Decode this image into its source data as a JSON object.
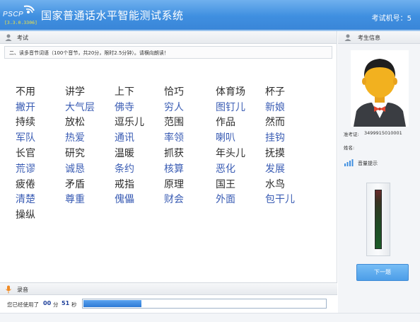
{
  "header": {
    "logo_text": "PSCP",
    "version": "[3.3.0.3306]",
    "title": "国家普通话水平智能测试系统",
    "machine_label": "考试机号：5"
  },
  "exam_panel": {
    "title": "考试",
    "instruction": "二、读多音节词语（100个音节，共20分，限时2.5分钟）。请横向朗读！"
  },
  "word_rows": [
    {
      "style": "black",
      "words": [
        "不用",
        "讲学",
        "上下",
        "恰巧",
        "体育场",
        "杯子"
      ]
    },
    {
      "style": "blue",
      "words": [
        "撇开",
        "大气层",
        "佛寺",
        "穷人",
        "图钉儿",
        "新娘"
      ]
    },
    {
      "style": "black",
      "words": [
        "持续",
        "放松",
        "逗乐儿",
        "范围",
        "作品",
        "然而"
      ]
    },
    {
      "style": "blue",
      "words": [
        "军队",
        "热爱",
        "通讯",
        "率领",
        "喇叭",
        "挂钩"
      ]
    },
    {
      "style": "black",
      "words": [
        "长官",
        "研究",
        "温暖",
        "抓获",
        "年头儿",
        "抚摸"
      ]
    },
    {
      "style": "blue",
      "words": [
        "荒谬",
        "诚恳",
        "条约",
        "核算",
        "恶化",
        "发展"
      ]
    },
    {
      "style": "black",
      "words": [
        "疲倦",
        "矛盾",
        "戒指",
        "原理",
        "国王",
        "水鸟"
      ]
    },
    {
      "style": "blue",
      "words": [
        "清楚",
        "尊重",
        "傀儡",
        "财会",
        "外面",
        "包干儿"
      ]
    },
    {
      "style": "black",
      "words": [
        "操纵"
      ]
    }
  ],
  "record": {
    "title": "录音",
    "used_label": "您已经使用了",
    "minutes": "00",
    "minutes_unit": "分",
    "seconds": "51",
    "seconds_unit": "秒",
    "progress": 0.24
  },
  "side": {
    "examinee_title": "考生信息",
    "ticket_label": "准考证:",
    "ticket_value": "3499915010001",
    "name_label": "姓名:",
    "volume_title": "音量提示",
    "next_button": "下一题"
  },
  "colors": {
    "header": "#3f8fe0",
    "blue_word": "#3b5db4",
    "black_word": "#2d2d2d",
    "progress": "#2c79d5",
    "accent_yellow": "#f2e341"
  }
}
